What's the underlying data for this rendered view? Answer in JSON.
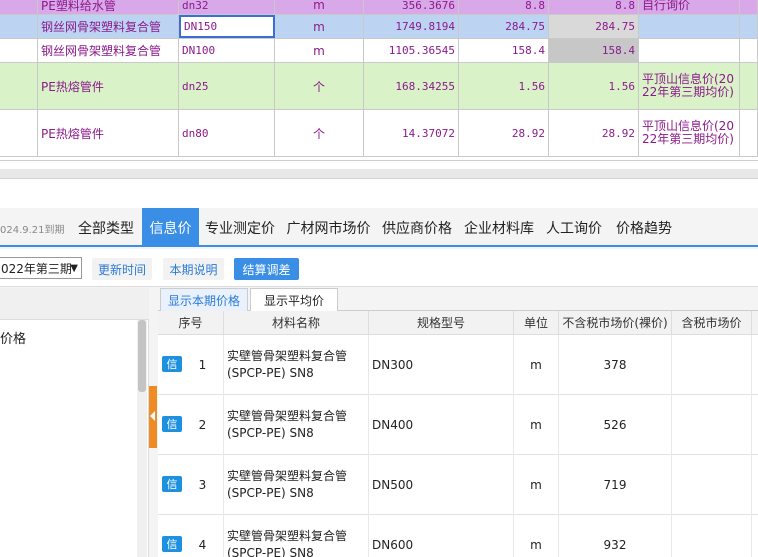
{
  "top_grid": {
    "rows": [
      {
        "name": "PE塑料给水管",
        "spec": "dn32",
        "unit": "m",
        "qty": "356.3676",
        "price": "8.8",
        "total": "8.8",
        "note": "自行询价",
        "bg": "#d9a8e8"
      },
      {
        "name": "钢丝网骨架塑料复合管",
        "spec": "DN150",
        "unit": "m",
        "qty": "1749.8194",
        "price": "284.75",
        "total": "284.75",
        "note": "",
        "bg": "#bcd4f2"
      },
      {
        "name": "钢丝网骨架塑料复合管",
        "spec": "DN100",
        "unit": "m",
        "qty": "1105.36545",
        "price": "158.4",
        "total": "158.4",
        "note": "",
        "bg": "#ffffff"
      },
      {
        "name": "PE热熔管件",
        "spec": "dn25",
        "unit": "个",
        "qty": "168.34255",
        "price": "1.56",
        "total": "1.56",
        "note": "平顶山信息价(2022年第三期均价)",
        "bg": "#d9f2c7"
      },
      {
        "name": "PE热熔管件",
        "spec": "dn80",
        "unit": "个",
        "qty": "14.37072",
        "price": "28.92",
        "total": "28.92",
        "note": "平顶山信息价(2022年第三期均价)",
        "bg": "#ffffff"
      }
    ]
  },
  "panel": {
    "expire_text": "024.9.21到期",
    "tabs": [
      "全部类型",
      "信息价",
      "专业测定价",
      "广材网市场价",
      "供应商价格",
      "企业材料库",
      "人工询价",
      "价格趋势"
    ],
    "active_tab": "信息价",
    "toolbar": {
      "period_value": "022年第三期",
      "period_arrow": "▼",
      "update_time_label": "更新时间",
      "period_desc_label": "本期说明",
      "settle_adjust_label": "结算调差"
    },
    "left_tree": {
      "item": "价格"
    },
    "subtabs": [
      "显示本期价格",
      "显示平均价"
    ],
    "table": {
      "headers": [
        "序号",
        "材料名称",
        "规格型号",
        "单位",
        "不含税市场价(裸价)",
        "含税市场价"
      ],
      "badge": "信",
      "rows": [
        {
          "no": "1",
          "name": "实壁管骨架塑料复合管(SPCP-PE) SN8",
          "spec": "DN300",
          "unit": "m",
          "price": "378",
          "tax_price": ""
        },
        {
          "no": "2",
          "name": "实壁管骨架塑料复合管(SPCP-PE) SN8",
          "spec": "DN400",
          "unit": "m",
          "price": "526",
          "tax_price": ""
        },
        {
          "no": "3",
          "name": "实壁管骨架塑料复合管(SPCP-PE) SN8",
          "spec": "DN500",
          "unit": "m",
          "price": "719",
          "tax_price": ""
        },
        {
          "no": "4",
          "name": "实壁管骨架塑料复合管(SPCP-PE) SN8",
          "spec": "DN600",
          "unit": "m",
          "price": "932",
          "tax_price": ""
        }
      ]
    }
  },
  "colors": {
    "accent": "#3a8ee6",
    "badge": "#1d90e0",
    "handle": "#f08a24",
    "grid_text": "#8b1a8b"
  }
}
